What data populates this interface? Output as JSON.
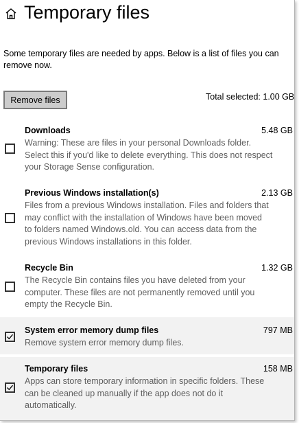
{
  "header": {
    "home_icon": "home-icon",
    "title": "Temporary files"
  },
  "intro": {
    "line1": "Some temporary files are needed by apps. Below is a list of files you can",
    "line2": "remove now."
  },
  "actions": {
    "remove_label": "Remove files",
    "total_selected": "Total selected: 1.00 GB"
  },
  "items": [
    {
      "title": "Downloads",
      "size": "5.48 GB",
      "checked": false,
      "desc": [
        "Warning: These are files in your personal Downloads folder.",
        "Select this if you'd like to delete everything. This does not respect",
        "your Storage Sense configuration."
      ]
    },
    {
      "title": "Previous Windows installation(s)",
      "size": "2.13 GB",
      "checked": false,
      "desc": [
        "Files from a previous Windows installation.  Files and folders that",
        "may conflict with the installation of Windows have been moved",
        "to folders named Windows.old.  You can access data from the",
        "previous Windows installations in this folder."
      ]
    },
    {
      "title": "Recycle Bin",
      "size": "1.32 GB",
      "checked": false,
      "desc": [
        "The Recycle Bin contains files you have deleted from your",
        "computer. These files are not permanently removed until you",
        "empty the Recycle Bin."
      ]
    },
    {
      "title": "System error memory dump files",
      "size": "797 MB",
      "checked": true,
      "desc": [
        "Remove system error memory dump files."
      ]
    },
    {
      "title": "Temporary files",
      "size": "158 MB",
      "checked": true,
      "desc": [
        "Apps can store temporary information in specific folders. These",
        "can be cleaned up manually if the app does not do it",
        "automatically."
      ]
    }
  ],
  "colors": {
    "selected_row": "#f2f2f2",
    "description_text": "#5f5f5f",
    "button_bg": "#cccccc",
    "button_border": "#7a7a7a"
  }
}
